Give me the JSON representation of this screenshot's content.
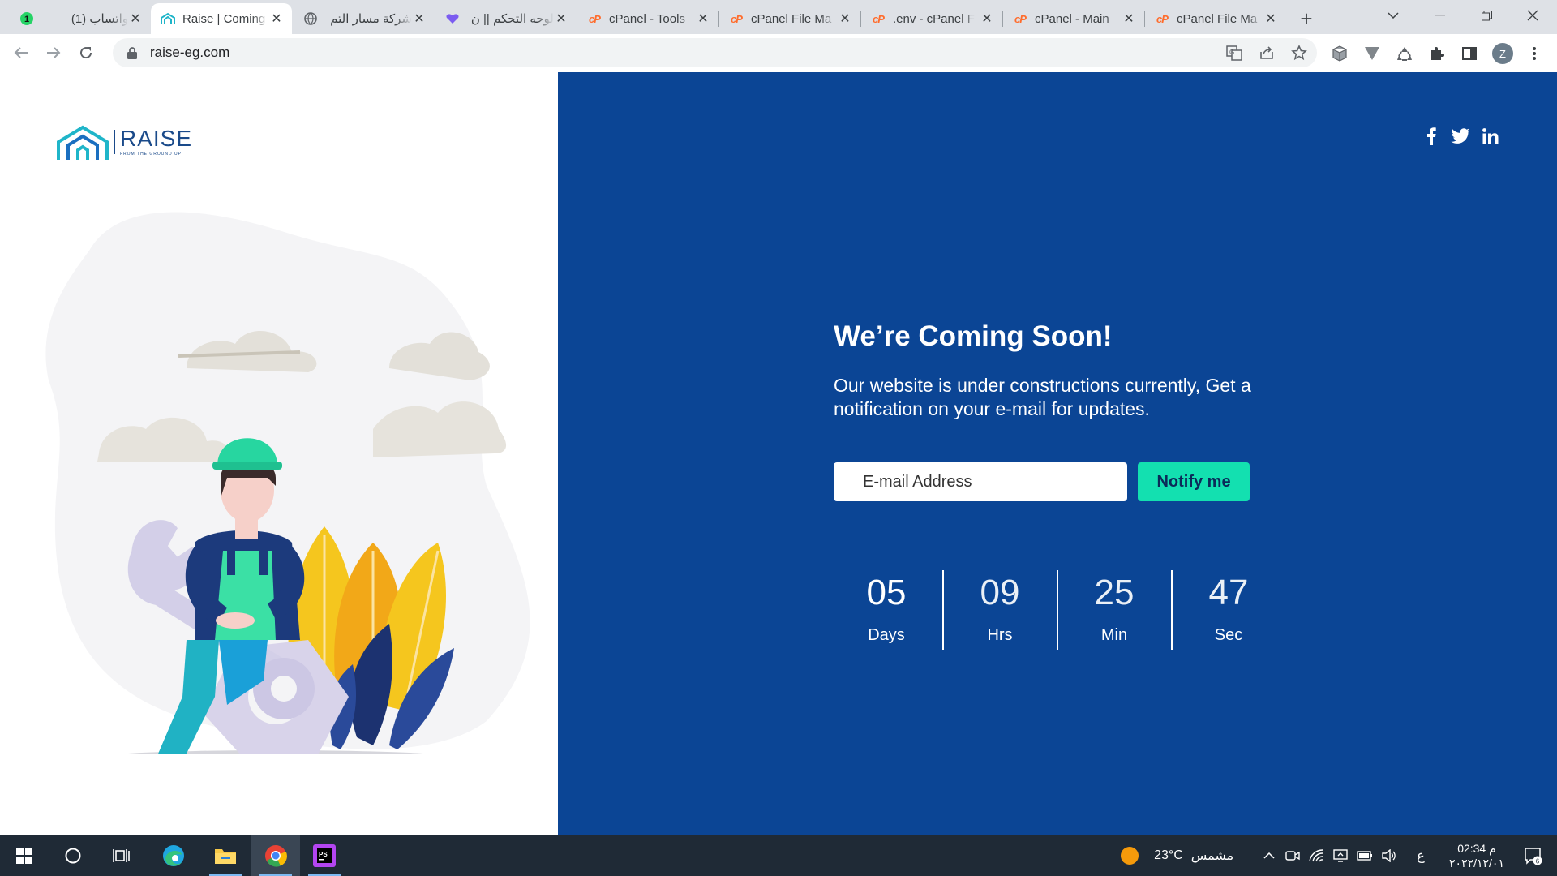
{
  "browser": {
    "tabs": [
      {
        "title": "(1) واتساب",
        "icon": "whatsapp-icon"
      },
      {
        "title": "Raise | Coming Soon",
        "icon": "raise-logo-icon",
        "active": true
      },
      {
        "title": "شركة مسار التم",
        "icon": "globe-icon"
      },
      {
        "title": "لوحه التحكم || ن",
        "icon": "heart-icon"
      },
      {
        "title": "cPanel - Tools",
        "icon": "cpanel-icon"
      },
      {
        "title": "cPanel File Ma",
        "icon": "cpanel-icon"
      },
      {
        "title": ".env - cPanel F",
        "icon": "cpanel-icon"
      },
      {
        "title": "cPanel - Main",
        "icon": "cpanel-icon"
      },
      {
        "title": "cPanel File Ma",
        "icon": "cpanel-icon"
      }
    ],
    "whatsapp_badge": "1",
    "url": "raise-eg.com",
    "profile_initial": "Z"
  },
  "page": {
    "logo": {
      "word": "RAISE",
      "tagline": "FROM THE GROUND UP"
    },
    "title": "We’re Coming Soon!",
    "description": "Our website is under constructions currently, Get a notification on your e-mail for updates.",
    "email_placeholder": "E-mail Address",
    "notify_label": "Notify me",
    "countdown": [
      {
        "value": "05",
        "label": "Days"
      },
      {
        "value": "09",
        "label": "Hrs"
      },
      {
        "value": "25",
        "label": "Min"
      },
      {
        "value": "47",
        "label": "Sec"
      }
    ],
    "social": [
      "facebook-icon",
      "twitter-icon",
      "linkedin-icon"
    ],
    "colors": {
      "panel": "#0b4595",
      "accent": "#13e0b0"
    }
  },
  "taskbar": {
    "weather_temp": "23°C",
    "weather_text": "مشمس",
    "lang": "ع",
    "time": "02:34 م",
    "date": "٢٠٢٢/١٢/٠١",
    "notification_count": "6"
  }
}
